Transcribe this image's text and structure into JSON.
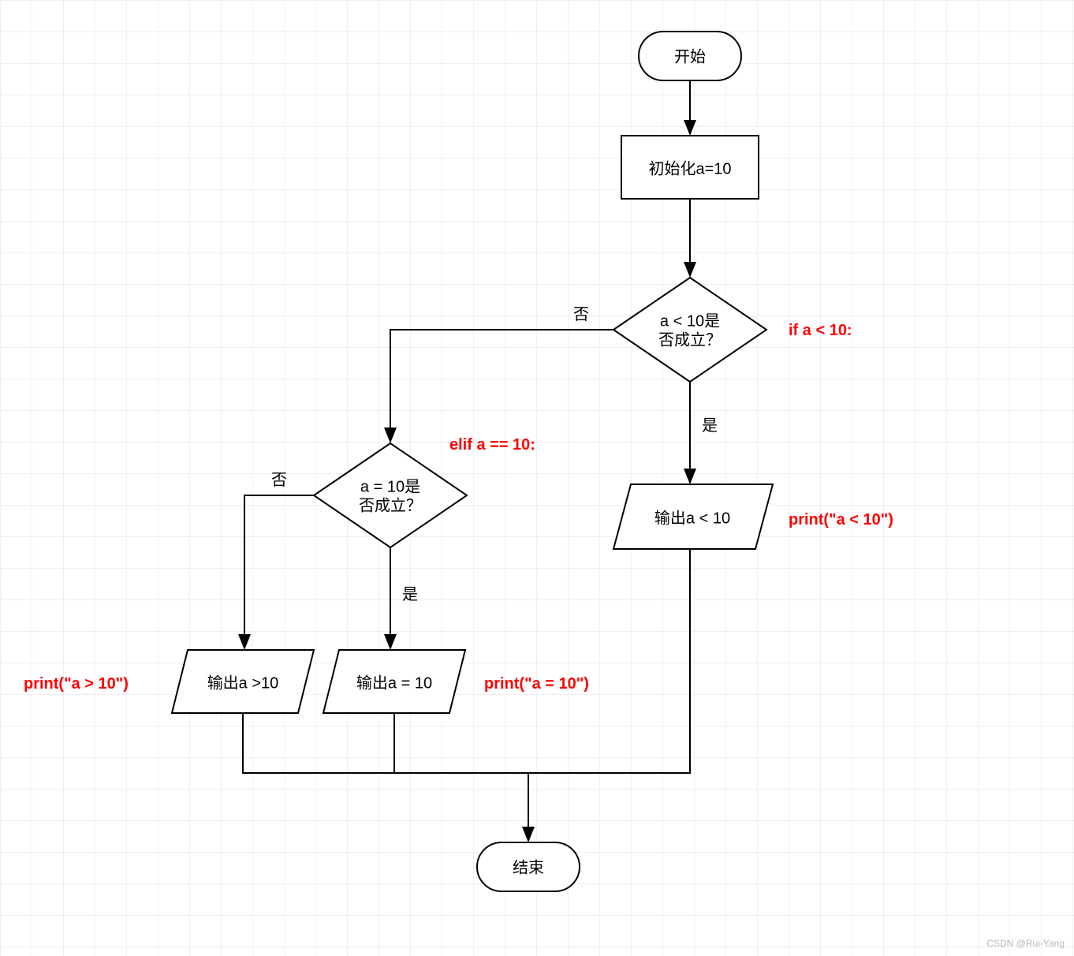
{
  "nodes": {
    "start": "开始",
    "init": "初始化a=10",
    "dec1_l1": "a < 10是",
    "dec1_l2": "否成立？",
    "dec2_l1": "a = 10是",
    "dec2_l2": "否成立？",
    "out_lt": "输出a < 10",
    "out_eq": "输出a = 10",
    "out_gt": "输出a >10",
    "end": "结束"
  },
  "labels": {
    "no1": "否",
    "yes1": "是",
    "no2": "否",
    "yes2": "是"
  },
  "annot": {
    "if": "if a < 10:",
    "elif": "elif a == 10:",
    "p_lt": "print(\"a < 10\")",
    "p_eq": "print(\"a = 10\")",
    "p_gt": "print(\"a > 10\")"
  },
  "watermark": "CSDN @Rui-Yang"
}
